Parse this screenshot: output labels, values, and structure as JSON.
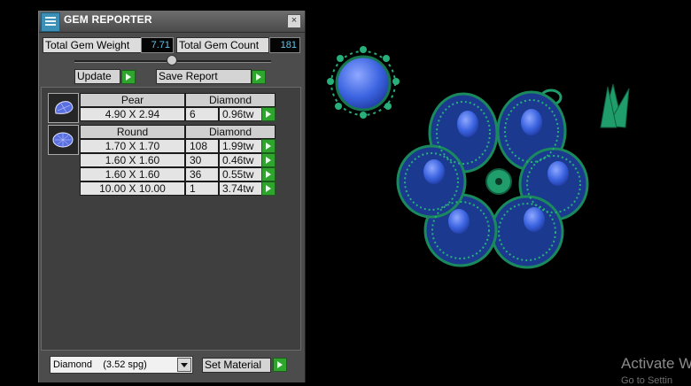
{
  "window": {
    "title": "GEM REPORTER",
    "close_glyph": "×"
  },
  "summary": {
    "weight_label": "Total Gem Weight",
    "weight_value": "7.71",
    "count_label": "Total Gem Count",
    "count_value": "181"
  },
  "actions": {
    "update_label": "Update",
    "save_label": "Save Report"
  },
  "groups": [
    {
      "shape": "Pear",
      "material": "Diamond",
      "icon": "pear-gem-icon",
      "rows": [
        {
          "size": "4.90 X 2.94",
          "count": "6",
          "weight": "0.96tw"
        }
      ]
    },
    {
      "shape": "Round",
      "material": "Diamond",
      "icon": "round-gem-icon",
      "rows": [
        {
          "size": "1.70 X 1.70",
          "count": "108",
          "weight": "1.99tw"
        },
        {
          "size": "1.60 X 1.60",
          "count": "30",
          "weight": "0.46tw"
        },
        {
          "size": "1.60 X 1.60",
          "count": "36",
          "weight": "0.55tw"
        },
        {
          "size": "10.00 X 10.00",
          "count": "1",
          "weight": "3.74tw"
        }
      ]
    }
  ],
  "material": {
    "selected": "Diamond",
    "gravity": "(3.52 spg)",
    "set_label": "Set Material"
  },
  "watermark": {
    "line1": "Activate W",
    "line2": "Go to Settin"
  },
  "colors": {
    "accent_value": "#5fc7ee",
    "go_button": "#2ea62e",
    "model_green": "#1f9d6b",
    "gem_blue": "#2f5bd6"
  }
}
